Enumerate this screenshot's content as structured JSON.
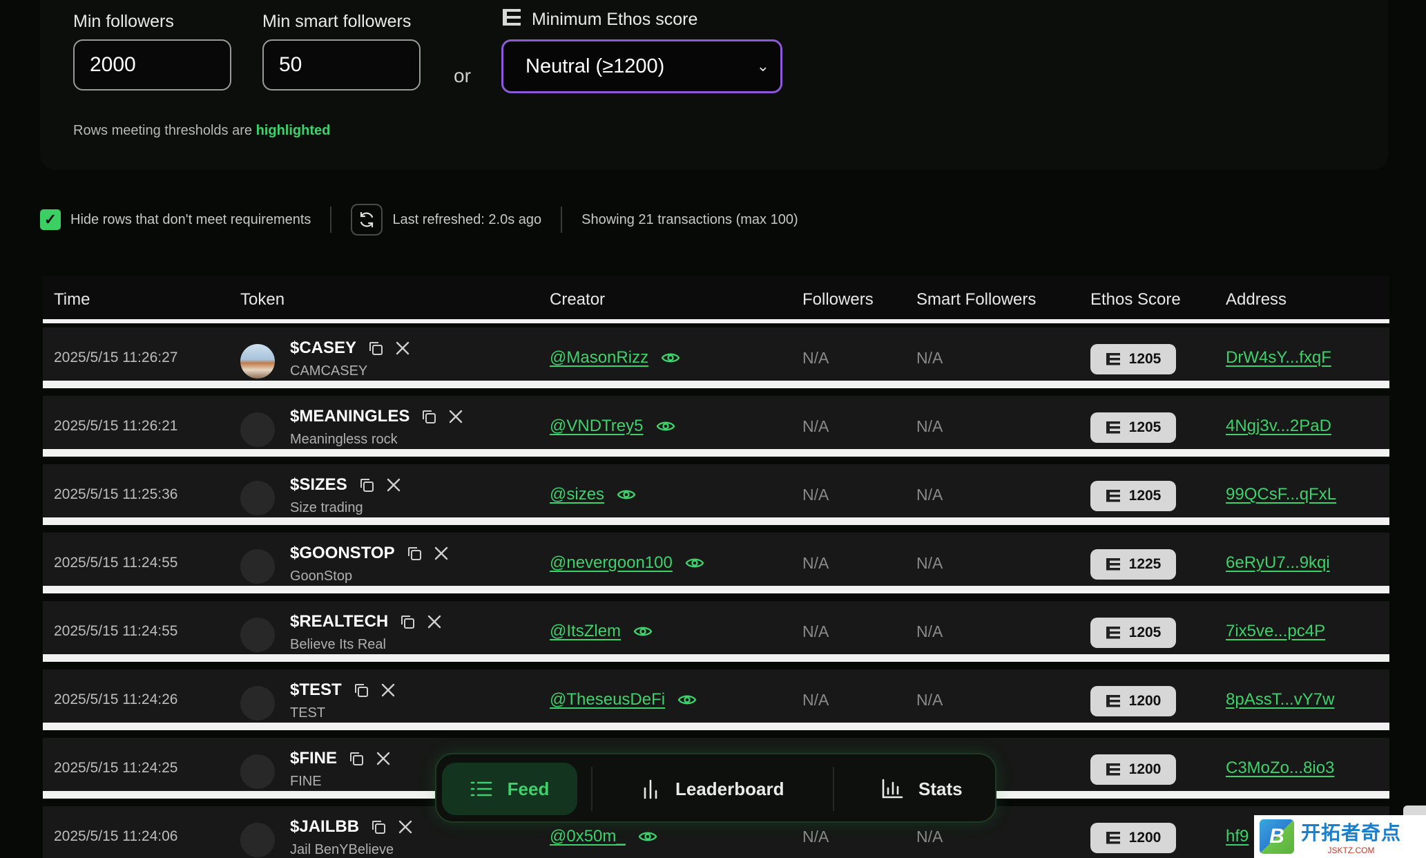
{
  "filters": {
    "min_followers_label": "Min followers",
    "min_followers_value": "2000",
    "min_smart_label": "Min smart followers",
    "min_smart_value": "50",
    "or_text": "or",
    "ethos_label": "Minimum Ethos score",
    "ethos_selected": "Neutral (≥1200)",
    "note_prefix": "Rows meeting thresholds are",
    "note_highlight": "highlighted"
  },
  "status": {
    "hide_rows_label": "Hide rows that don't meet requirements",
    "hide_rows_checked": true,
    "last_refreshed": "Last refreshed: 2.0s ago",
    "showing": "Showing 21 transactions (max 100)"
  },
  "table": {
    "headers": [
      "Time",
      "Token",
      "Creator",
      "Followers",
      "Smart Followers",
      "Ethos Score",
      "Address"
    ],
    "rows": [
      {
        "time": "2025/5/15 11:26:27",
        "symbol": "$CASEY",
        "name": "CAMCASEY",
        "creator": "@MasonRizz",
        "followers": "N/A",
        "smart": "N/A",
        "ethos": "1205",
        "address": "DrW4sY...fxqF"
      },
      {
        "time": "2025/5/15 11:26:21",
        "symbol": "$MEANINGLES",
        "name": "Meaningless rock",
        "creator": "@VNDTrey5",
        "followers": "N/A",
        "smart": "N/A",
        "ethos": "1205",
        "address": "4Ngj3v...2PaD"
      },
      {
        "time": "2025/5/15 11:25:36",
        "symbol": "$SIZES",
        "name": "Size trading",
        "creator": "@sizes",
        "followers": "N/A",
        "smart": "N/A",
        "ethos": "1205",
        "address": "99QCsF...qFxL"
      },
      {
        "time": "2025/5/15 11:24:55",
        "symbol": "$GOONSTOP",
        "name": "GoonStop",
        "creator": "@nevergoon100",
        "followers": "N/A",
        "smart": "N/A",
        "ethos": "1225",
        "address": "6eRyU7...9kqi"
      },
      {
        "time": "2025/5/15 11:24:55",
        "symbol": "$REALTECH",
        "name": "Believe Its Real",
        "creator": "@ItsZlem",
        "followers": "N/A",
        "smart": "N/A",
        "ethos": "1205",
        "address": "7ix5ve...pc4P"
      },
      {
        "time": "2025/5/15 11:24:26",
        "symbol": "$TEST",
        "name": "TEST",
        "creator": "@TheseusDeFi",
        "followers": "N/A",
        "smart": "N/A",
        "ethos": "1200",
        "address": "8pAssT...vY7w"
      },
      {
        "time": "2025/5/15 11:24:25",
        "symbol": "$FINE",
        "name": "FINE",
        "creator": "",
        "followers": "",
        "smart": "",
        "ethos": "1200",
        "address": "C3MoZo...8io3"
      },
      {
        "time": "2025/5/15 11:24:06",
        "symbol": "$JAILBB",
        "name": "Jail BenYBelieve",
        "creator": "@0x50m_",
        "followers": "N/A",
        "smart": "N/A",
        "ethos": "1200",
        "address": "hf9"
      }
    ]
  },
  "nav": {
    "feed": "Feed",
    "leaderboard": "Leaderboard",
    "stats": "Stats"
  },
  "watermark": {
    "logo_letter": "B",
    "cn": "开拓者奇点",
    "url": "JSKTZ.COM"
  },
  "colors": {
    "accent_green": "#3fd16b",
    "select_border": "#8c5ad8"
  }
}
